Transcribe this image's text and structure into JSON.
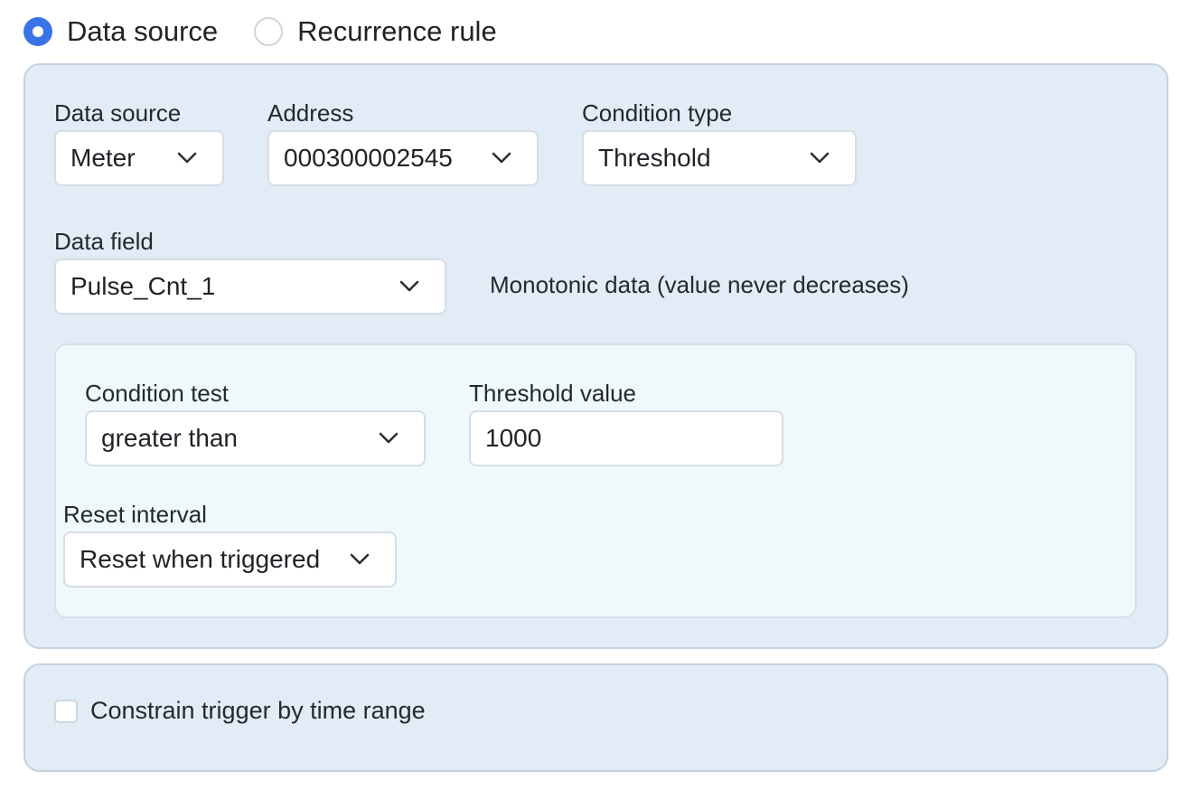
{
  "mode": {
    "options": [
      {
        "label": "Data source",
        "checked": true
      },
      {
        "label": "Recurrence rule",
        "checked": false
      }
    ]
  },
  "source": {
    "data_source_label": "Data source",
    "data_source_value": "Meter",
    "address_label": "Address",
    "address_value": "000300002545",
    "condition_type_label": "Condition type",
    "condition_type_value": "Threshold",
    "data_field_label": "Data field",
    "data_field_value": "Pulse_Cnt_1",
    "monotonic_note": "Monotonic data (value never decreases)"
  },
  "condition": {
    "test_label": "Condition test",
    "test_value": "greater than",
    "threshold_label": "Threshold value",
    "threshold_value": "1000",
    "reset_label": "Reset interval",
    "reset_value": "Reset when triggered"
  },
  "constraint": {
    "checkbox_label": "Constrain trigger by time range",
    "checked": false
  },
  "colors": {
    "accent": "#3874e8",
    "panel_bg": "#e2ecf6",
    "inner_bg": "#eff8fb"
  }
}
